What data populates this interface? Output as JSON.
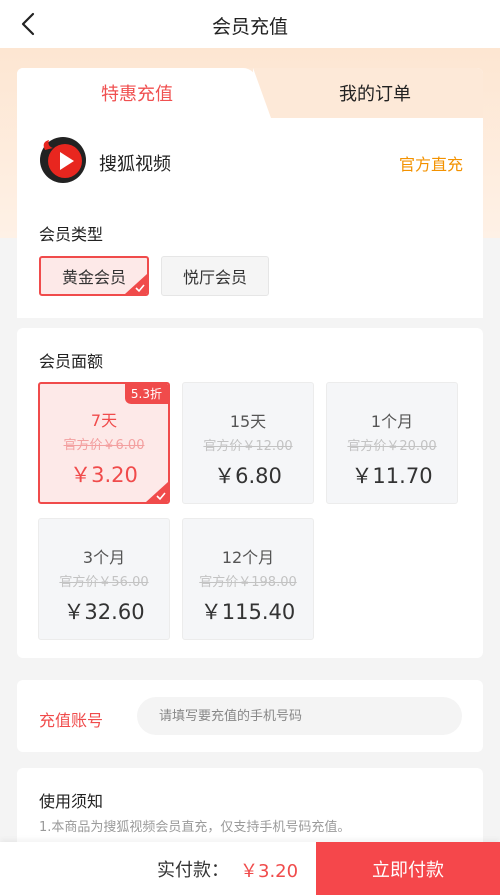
{
  "header": {
    "title": "会员充值"
  },
  "tabs": {
    "active": "特惠充值",
    "orders": "我的订单"
  },
  "brand": {
    "name": "搜狐视频",
    "tag": "官方直充",
    "logo_icon": "sohu-video-logo-icon"
  },
  "member_type": {
    "title": "会员类型",
    "options": [
      {
        "label": "黄金会员",
        "selected": true
      },
      {
        "label": "悦厅会员",
        "selected": false
      }
    ]
  },
  "amount": {
    "title": "会员面额",
    "plans": [
      {
        "name": "7天",
        "orig": "官方价￥6.00",
        "price": "￥3.20",
        "badge": "5.3折",
        "selected": true
      },
      {
        "name": "15天",
        "orig": "官方价￥12.00",
        "price": "￥6.80"
      },
      {
        "name": "1个月",
        "orig": "官方价￥20.00",
        "price": "￥11.70"
      },
      {
        "name": "3个月",
        "orig": "官方价￥56.00",
        "price": "￥32.60"
      },
      {
        "name": "12个月",
        "orig": "官方价￥198.00",
        "price": "￥115.40"
      }
    ]
  },
  "account": {
    "label": "充值账号",
    "placeholder": "请填写要充值的手机号码",
    "value": ""
  },
  "notice": {
    "title": "使用须知",
    "lines": [
      "1.本商品为搜狐视频会员直充，仅支持手机号码充值。"
    ]
  },
  "footer": {
    "pay_label": "实付款：",
    "pay_amount": "￥3.20",
    "pay_button": "立即付款"
  },
  "colors": {
    "accent": "#f04b4b",
    "orange": "#f39200",
    "peach": "#fde9d8"
  }
}
